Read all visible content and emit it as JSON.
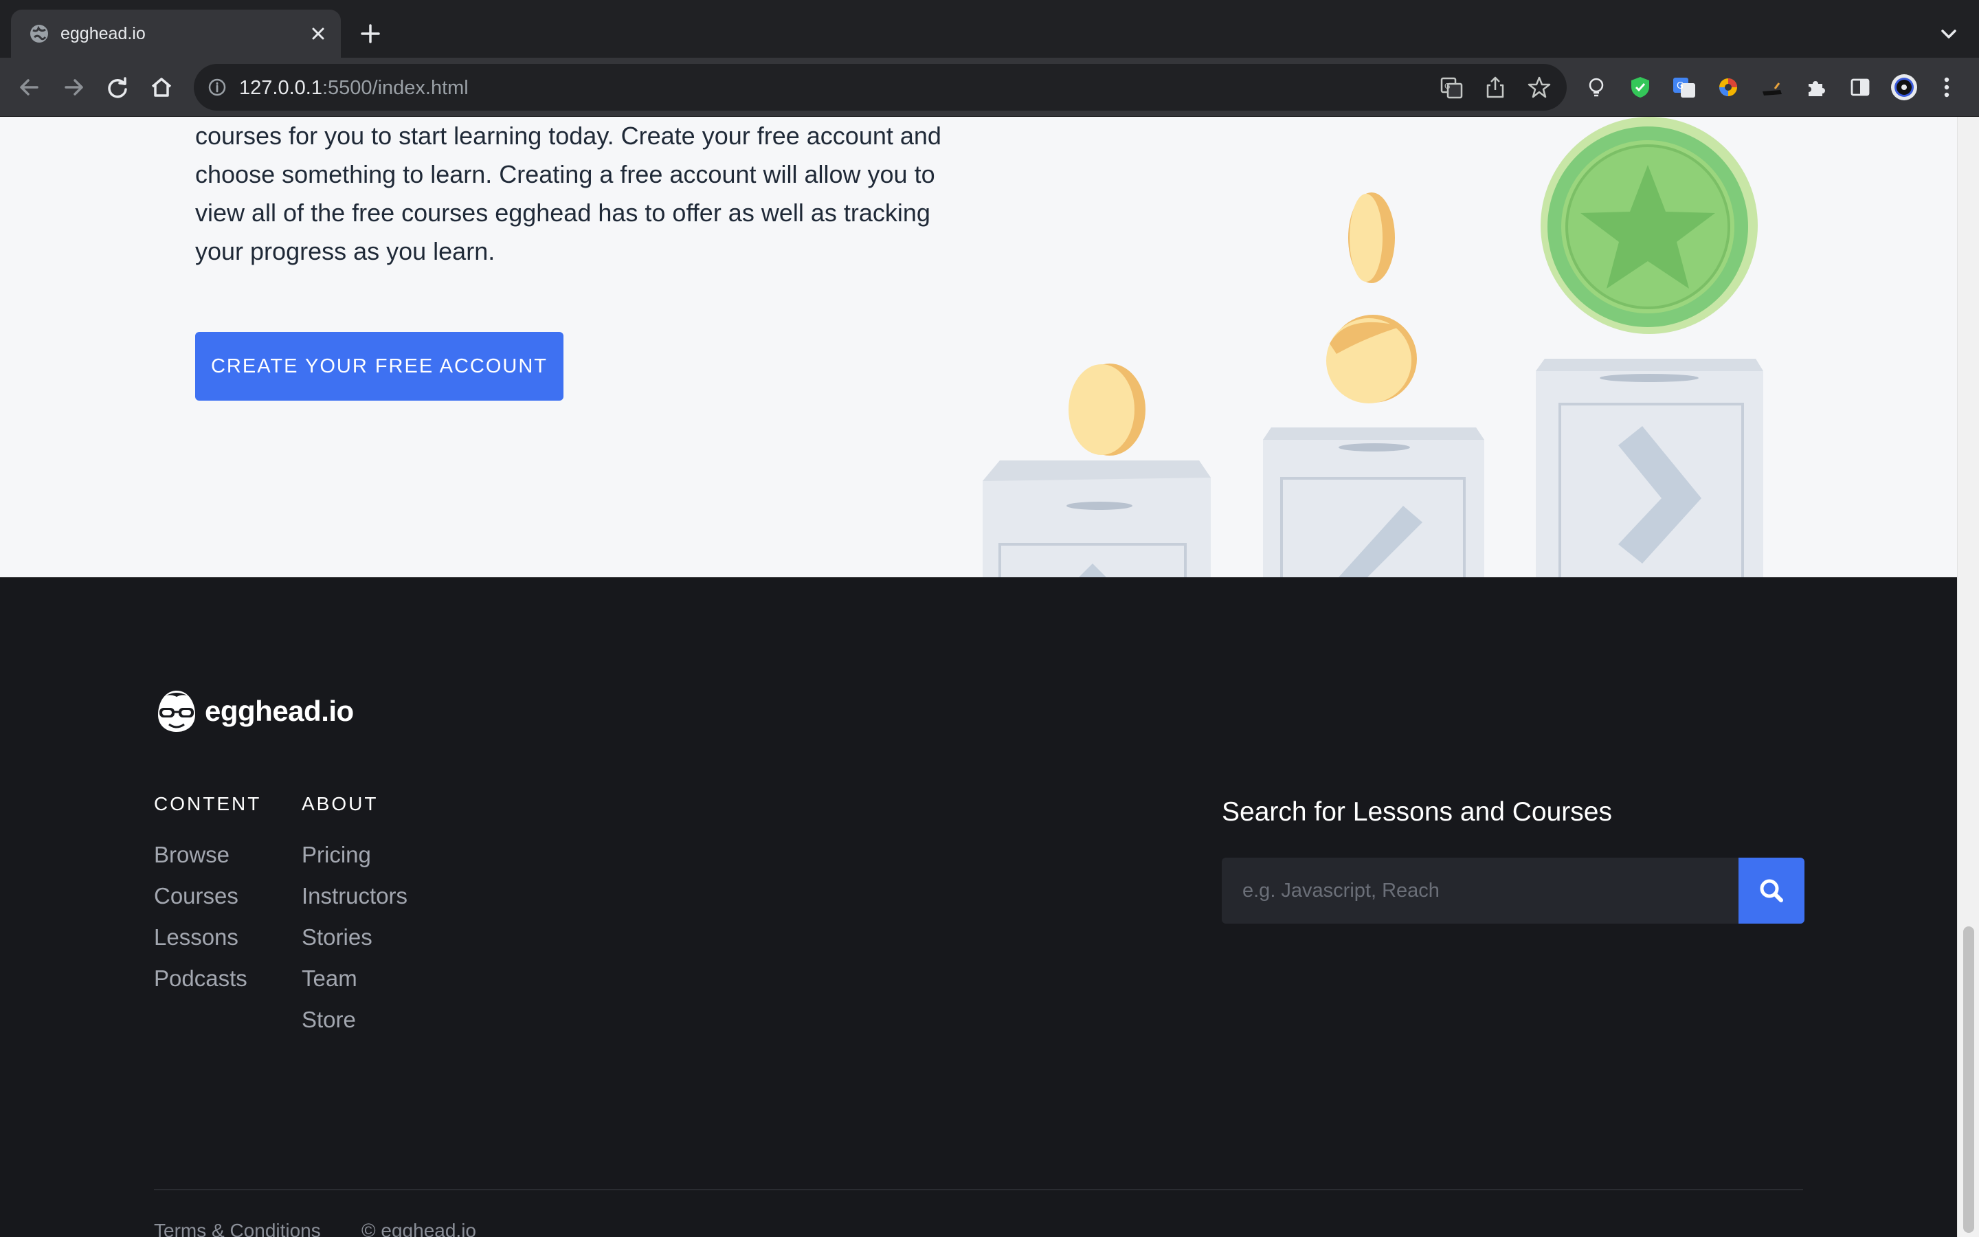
{
  "browser": {
    "tab_title": "egghead.io",
    "url_host": "127.0.0.1",
    "url_rest": ":5500/index.html"
  },
  "hero": {
    "text": "courses for you to start learning today. Create your free account and choose something to learn. Creating a free account will allow you to view all of the free courses egghead has to offer as well as tracking your progress as you learn.",
    "cta_label": "CREATE YOUR FREE ACCOUNT"
  },
  "footer": {
    "brand": "egghead.io",
    "content": {
      "heading": "CONTENT",
      "links": [
        "Browse",
        "Courses",
        "Lessons",
        "Podcasts"
      ]
    },
    "about": {
      "heading": "ABOUT",
      "links": [
        "Pricing",
        "Instructors",
        "Stories",
        "Team",
        "Store"
      ]
    },
    "search": {
      "title": "Search for Lessons and Courses",
      "placeholder": "e.g. Javascript, Reach"
    },
    "legal": {
      "terms": "Terms & Conditions",
      "copyright": "© egghead.io"
    }
  },
  "colors": {
    "accent": "#3e71f2",
    "footer_bg": "#17181c",
    "hero_bg": "#f6f7f9"
  },
  "icons": [
    "globe-icon",
    "close-icon",
    "plus-icon",
    "chevron-down-icon",
    "back-icon",
    "forward-icon",
    "reload-icon",
    "home-icon",
    "info-icon",
    "translate-icon",
    "share-icon",
    "star-icon",
    "extensions-icon",
    "sidepanel-icon",
    "search-icon"
  ]
}
